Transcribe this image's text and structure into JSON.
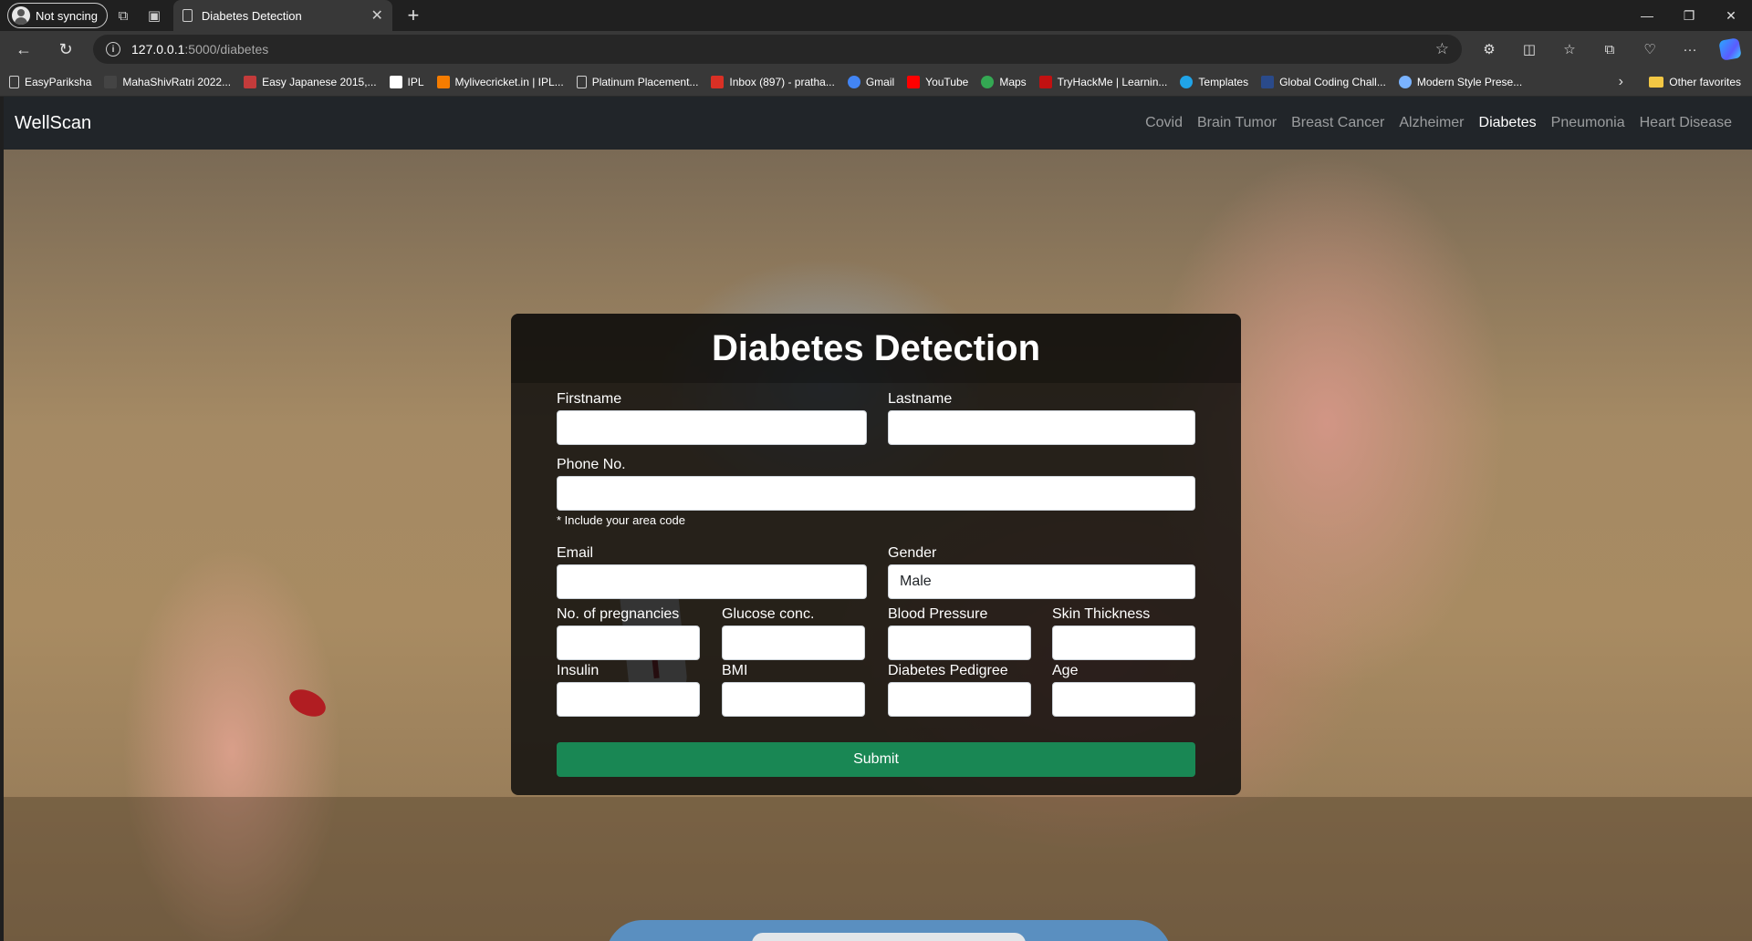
{
  "browser": {
    "profile_label": "Not syncing",
    "tab_title": "Diabetes Detection",
    "url_host": "127.0.0.1",
    "url_path": ":5000/diabetes",
    "bookmarks": [
      {
        "label": "EasyPariksha",
        "icon": "page-icon",
        "color": "#d0d0d0"
      },
      {
        "label": "MahaShivRatri 2022...",
        "icon": "trident-icon",
        "color": "#444444"
      },
      {
        "label": "Easy Japanese 2015,...",
        "icon": "calendar-icon",
        "color": "#c43b3b"
      },
      {
        "label": "IPL",
        "icon": "square-icon",
        "color": "#ffffff"
      },
      {
        "label": "Mylivecricket.in | IPL...",
        "icon": "blogger-icon",
        "color": "#f57c00"
      },
      {
        "label": "Platinum Placement...",
        "icon": "page-icon",
        "color": "#d0d0d0"
      },
      {
        "label": "Inbox (897) - pratha...",
        "icon": "gmail-icon",
        "color": "#d93025"
      },
      {
        "label": "Gmail",
        "icon": "google-icon",
        "color": "#4285f4"
      },
      {
        "label": "YouTube",
        "icon": "youtube-icon",
        "color": "#ff0000"
      },
      {
        "label": "Maps",
        "icon": "maps-icon",
        "color": "#34a853"
      },
      {
        "label": "TryHackMe | Learnin...",
        "icon": "tryhackme-icon",
        "color": "#c11111"
      },
      {
        "label": "Templates",
        "icon": "canva-icon",
        "color": "#20a4e8"
      },
      {
        "label": "Global Coding Chall...",
        "icon": "coding-icon",
        "color": "#2a4a8a"
      },
      {
        "label": "Modern Style Prese...",
        "icon": "slides-icon",
        "color": "#7ab3ff"
      }
    ],
    "other_favorites": "Other favorites"
  },
  "site": {
    "brand": "WellScan",
    "nav": [
      "Covid",
      "Brain Tumor",
      "Breast Cancer",
      "Alzheimer",
      "Diabetes",
      "Pneumonia",
      "Heart Disease"
    ],
    "active_nav": "Diabetes"
  },
  "form": {
    "title": "Diabetes Detection",
    "firstname_label": "Firstname",
    "lastname_label": "Lastname",
    "phone_label": "Phone No.",
    "phone_hint": "* Include your area code",
    "email_label": "Email",
    "gender_label": "Gender",
    "gender_value": "Male",
    "pregnancies_label": "No. of pregnancies",
    "glucose_label": "Glucose conc.",
    "bp_label": "Blood Pressure",
    "skin_label": "Skin Thickness",
    "insulin_label": "Insulin",
    "bmi_label": "BMI",
    "pedigree_label": "Diabetes Pedigree",
    "age_label": "Age",
    "submit_label": "Submit"
  },
  "colors": {
    "navbar_bg": "#212529",
    "submit_bg": "#198754",
    "card_bg": "rgba(10,10,10,0.82)"
  }
}
